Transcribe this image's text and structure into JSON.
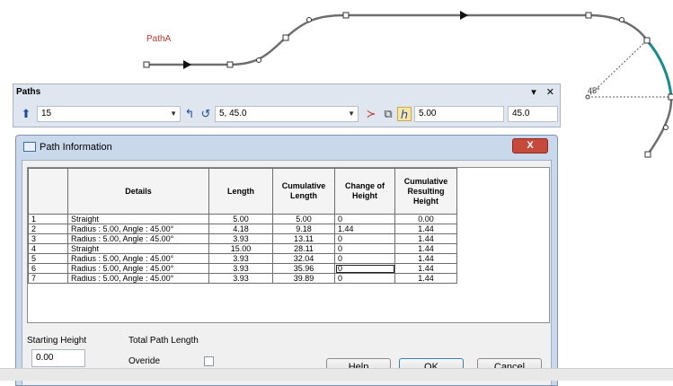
{
  "canvas": {
    "path_label": "PathA",
    "angle_label": "45°"
  },
  "paths_toolbar": {
    "title": "Paths",
    "pin_glyph": "▾",
    "close_glyph": "✕",
    "count_value": "15",
    "radius_angle_value": "5, 45.0",
    "height_value": "5.00",
    "angle_value": "45.0"
  },
  "dialog": {
    "title": "Path Information",
    "close_glyph": "X",
    "columns": [
      "",
      "Details",
      "Length",
      "Cumulative Length",
      "Change of Height",
      "Cumulative Resulting Height"
    ],
    "rows": [
      {
        "num": "1",
        "details": "Straight",
        "length": "5.00",
        "cum_length": "5.00",
        "change": "0",
        "cum_height": "0.00"
      },
      {
        "num": "2",
        "details": "Radius : 5.00, Angle : 45.00°",
        "length": "4.18",
        "cum_length": "9.18",
        "change": "1.44",
        "cum_height": "1.44"
      },
      {
        "num": "3",
        "details": "Radius : 5.00, Angle : 45.00°",
        "length": "3.93",
        "cum_length": "13.11",
        "change": "0",
        "cum_height": "1.44"
      },
      {
        "num": "4",
        "details": "Straight",
        "length": "15.00",
        "cum_length": "28.11",
        "change": "0",
        "cum_height": "1.44"
      },
      {
        "num": "5",
        "details": "Radius : 5.00, Angle : 45.00°",
        "length": "3.93",
        "cum_length": "32.04",
        "change": "0",
        "cum_height": "1.44"
      },
      {
        "num": "6",
        "details": "Radius : 5.00, Angle : 45.00°",
        "length": "3.93",
        "cum_length": "35.96",
        "change": "0",
        "cum_height": "1.44"
      },
      {
        "num": "7",
        "details": "Radius : 5.00, Angle : 45.00°",
        "length": "3.93",
        "cum_length": "39.89",
        "change": "0",
        "cum_height": "1.44"
      }
    ],
    "starting_height_label": "Starting Height",
    "starting_height_value": "0.00",
    "total_path_length_label": "Total Path Length",
    "override_label": "Overide",
    "help_label": "Help",
    "ok_label": "OK",
    "cancel_label": "Cancel"
  },
  "colors": {
    "path_stroke": "#6e6e6e",
    "path_highlight": "#1a8c8c",
    "label_red": "#c0392b"
  }
}
